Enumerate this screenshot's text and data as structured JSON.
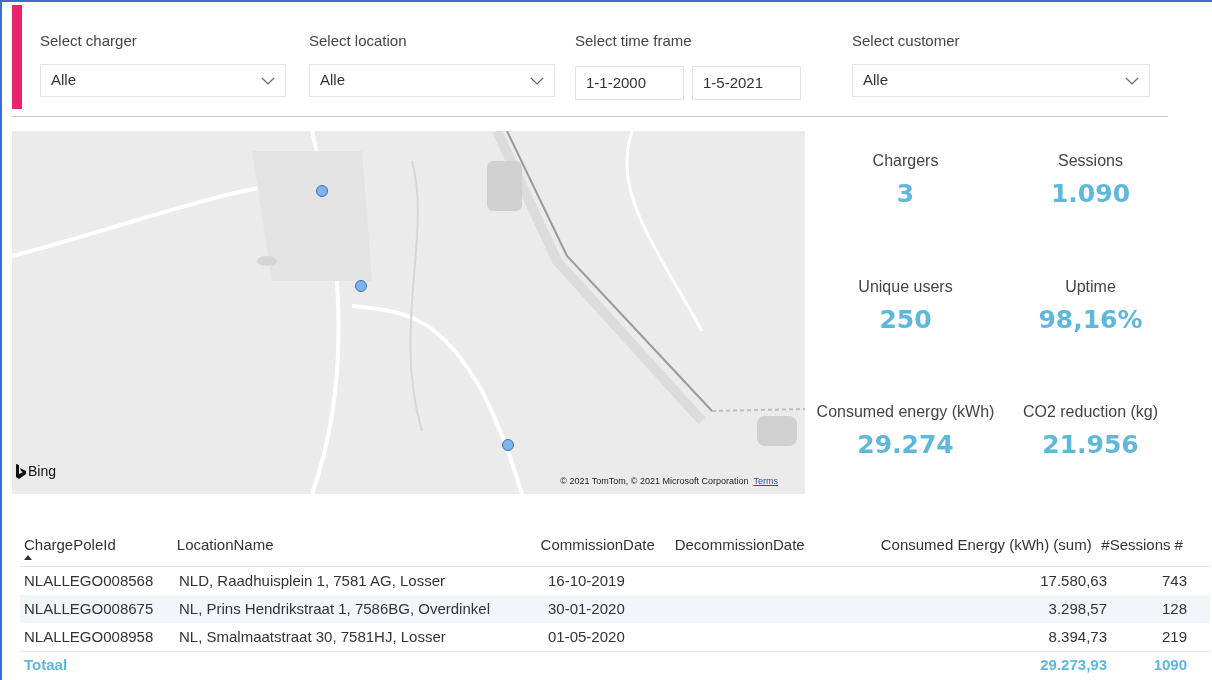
{
  "filters": [
    {
      "kind": "dropdown",
      "label": "Select charger",
      "value": "Alle"
    },
    {
      "kind": "dropdown",
      "label": "Select location",
      "value": "Alle"
    },
    {
      "kind": "dates",
      "label": "Select time frame",
      "from": "1-1-2000",
      "to": "1-5-2021"
    },
    {
      "kind": "dropdown",
      "label": "Select customer",
      "value": "Alle"
    }
  ],
  "map": {
    "kind": "picture",
    "logo": "Bing",
    "attribution": "© 2021 TomTom, © 2021 Microsoft Corporation",
    "terms_link": "Terms"
  },
  "kpis": [
    {
      "label": "Chargers",
      "value": "3"
    },
    {
      "label": "Sessions",
      "value": "1.090"
    },
    {
      "label": "Unique users",
      "value": "250"
    },
    {
      "label": "Uptime",
      "value": "98,16%"
    },
    {
      "label": "Consumed energy (kWh)",
      "value": "29.274"
    },
    {
      "label": "CO2 reduction (kg)",
      "value": "21.956"
    }
  ],
  "table": {
    "columns": [
      {
        "label": "ChargePoleId",
        "sorted": true
      },
      {
        "label": "LocationName",
        "sorted": false
      },
      {
        "label": "CommissionDate",
        "sorted": false
      },
      {
        "label": "DecommissionDate",
        "sorted": false
      },
      {
        "label": "Consumed Energy (kWh) (sum)",
        "sorted": false
      },
      {
        "label": "#Sessions",
        "sorted": false
      },
      {
        "label": "#",
        "sorted": false
      }
    ],
    "rows": [
      {
        "cells": [
          "NLALLEGO008568",
          "NLD, Raadhuisplein 1, 7581 AG, Losser",
          "16-10-2019",
          "",
          "17.580,63",
          "743"
        ],
        "selected": false
      },
      {
        "cells": [
          "NLALLEGO008675",
          "NL, Prins Hendrikstraat 1, 7586BG, Overdinkel",
          "30-01-2020",
          "",
          "3.298,57",
          "128"
        ],
        "selected": true
      },
      {
        "cells": [
          "NLALLEGO008958",
          "NL, Smalmaatstraat 30, 7581HJ, Losser",
          "01-05-2020",
          "",
          "8.394,73",
          "219"
        ],
        "selected": false
      }
    ],
    "total": {
      "label": "Totaal",
      "energy": "29.273,93",
      "sessions": "1090"
    }
  }
}
